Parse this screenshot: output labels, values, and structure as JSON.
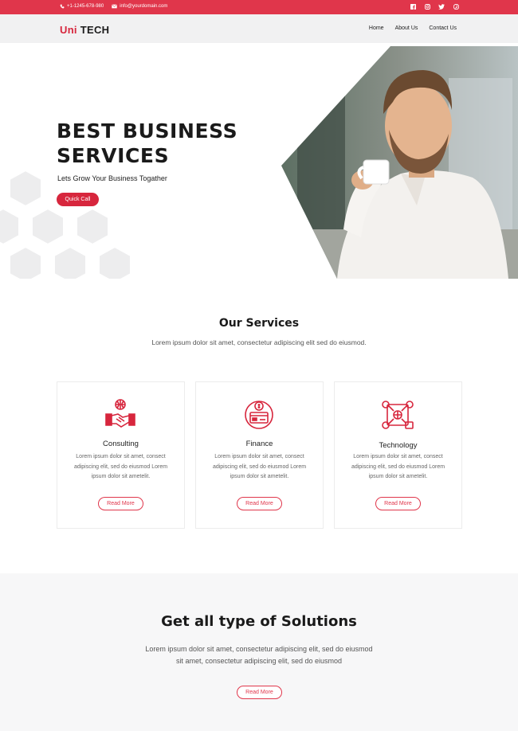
{
  "topbar": {
    "phone": "+1-1245-678-980",
    "email": "info@yourdomain.com",
    "social": [
      "facebook-icon",
      "instagram-icon",
      "twitter-icon",
      "pinterest-icon"
    ]
  },
  "nav": {
    "logo_uni": "Uni",
    "logo_tech": "TECH",
    "links": [
      "Home",
      "About Us",
      "Contact Us"
    ]
  },
  "hero": {
    "title_line1": "BEST BUSINESS",
    "title_line2": "SERVICES",
    "subtitle": "Lets Grow Your Business Togather",
    "button": "Quick Call"
  },
  "services": {
    "title": "Our Services",
    "subtitle": "Lorem ipsum dolor sit amet, consectetur adipiscing elit sed do eiusmod.",
    "cards": [
      {
        "title": "Consulting",
        "icon": "handshake-icon",
        "text": [
          "Lorem ipsum dolor sit amet, consect",
          "adipiscing elit, sed do eiusmod Lorem",
          "ipsum dolor sit ametelit."
        ],
        "button": "Read More"
      },
      {
        "title": "Finance",
        "icon": "finance-icon",
        "text": [
          "Lorem ipsum dolor sit amet, consect",
          "adipiscing elit, sed do eiusmod Lorem",
          "ipsum dolor sit ametelit."
        ],
        "button": "Read More"
      },
      {
        "title": "Technology",
        "icon": "technology-icon",
        "text": [
          "Lorem ipsum dolor sit amet, consect",
          "adipiscing elit, sed do eiusmod Lorem",
          "ipsum dolor sit ametelit."
        ],
        "button": "Read More"
      }
    ]
  },
  "solutions": {
    "title": "Get all type of Solutions",
    "text_line1": "Lorem ipsum dolor sit amet, consectetur adipiscing elit, sed do eiusmod",
    "text_line2": "sit amet, consectetur adipiscing elit, sed do eiusmod",
    "button": "Read More"
  },
  "colors": {
    "accent": "#e0364b",
    "accent_dark": "#d7263d"
  }
}
